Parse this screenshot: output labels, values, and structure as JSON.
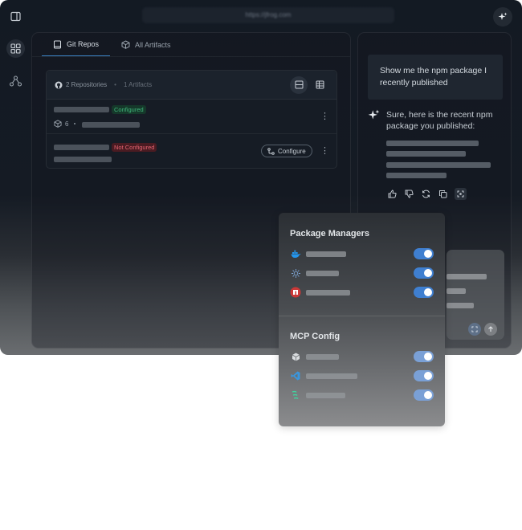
{
  "header": {
    "url": "https://jfrog.com",
    "sidebar_toggle_icon": "sidebar-toggle-icon",
    "assistant_icon": "sparkle-icon"
  },
  "nav": {
    "items": [
      {
        "icon": "dashboard-icon",
        "active": true
      },
      {
        "icon": "graph-nodes-icon",
        "active": false
      }
    ]
  },
  "main": {
    "tabs": [
      {
        "label": "Git Repos",
        "icon": "book-icon",
        "active": true
      },
      {
        "label": "All Artifacts",
        "icon": "package-icon",
        "active": false
      }
    ],
    "summary": {
      "repositories": "2 Repositories",
      "artifacts": "1 Artifacts"
    },
    "repos": [
      {
        "status": "Configured",
        "artifact_count": "6",
        "status_color": "#3fb57a"
      },
      {
        "status": "Not Configured",
        "action_label": "Configure",
        "status_color": "#e26471"
      }
    ]
  },
  "chat": {
    "user_message": "Show me the npm package I recently published",
    "assistant_message": "Sure, here is the recent npm package you published:"
  },
  "popup": {
    "package_managers_title": "Package Managers",
    "package_managers": [
      {
        "icon": "docker-icon",
        "enabled": true
      },
      {
        "icon": "helm-icon",
        "enabled": true
      },
      {
        "icon": "npm-icon",
        "enabled": true
      }
    ],
    "mcp_title": "MCP Config",
    "mcp_clients": [
      {
        "icon": "cursor-icon",
        "enabled": true
      },
      {
        "icon": "vscode-icon",
        "enabled": true
      },
      {
        "icon": "windsurf-icon",
        "enabled": true
      }
    ],
    "accent_color": "#3f7fd0"
  }
}
